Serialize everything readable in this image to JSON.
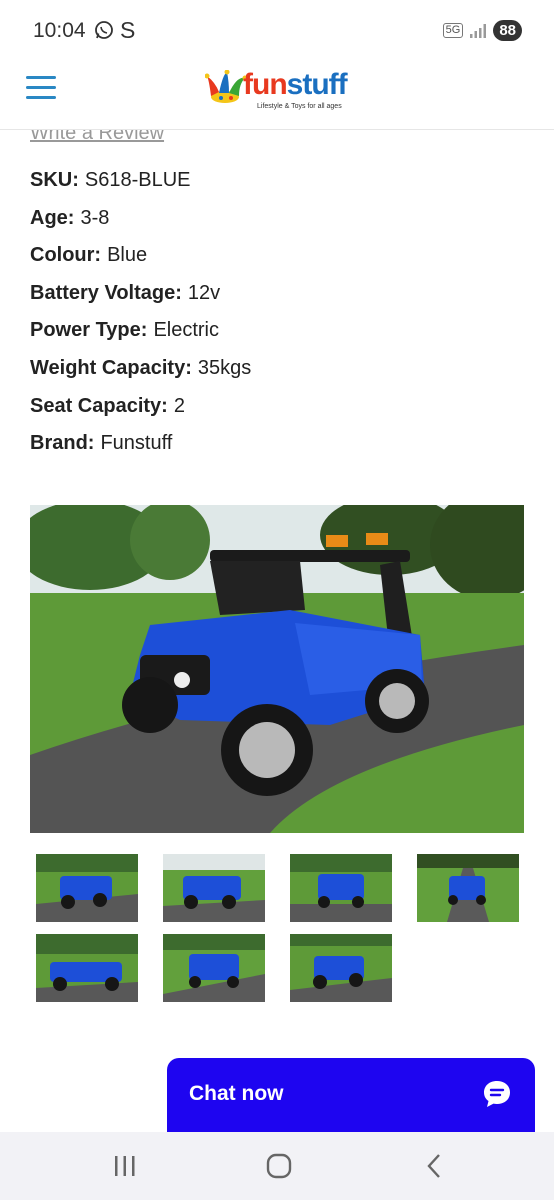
{
  "status": {
    "time": "10:04",
    "carrier_letter": "S",
    "network": "5G",
    "battery": "88"
  },
  "header": {
    "logo_text_fun": "fun",
    "logo_text_stuff": "stuff",
    "logo_tagline": "Lifestyle & Toys for all ages"
  },
  "product": {
    "review_link": "Write a Review",
    "specs": [
      {
        "key": "SKU:",
        "value": "S618-BLUE"
      },
      {
        "key": "Age:",
        "value": "3-8"
      },
      {
        "key": "Colour:",
        "value": "Blue"
      },
      {
        "key": "Battery Voltage:",
        "value": "12v"
      },
      {
        "key": "Power Type:",
        "value": "Electric"
      },
      {
        "key": "Weight Capacity:",
        "value": "35kgs"
      },
      {
        "key": "Seat Capacity:",
        "value": "2"
      },
      {
        "key": "Brand:",
        "value": "Funstuff"
      }
    ],
    "thumbnail_count": 7
  },
  "chat": {
    "label": "Chat now"
  },
  "colors": {
    "accent_blue": "#1e05f0",
    "menu_blue": "#2a88c4",
    "logo_red": "#e8391f",
    "logo_blue": "#1a6fc0"
  }
}
